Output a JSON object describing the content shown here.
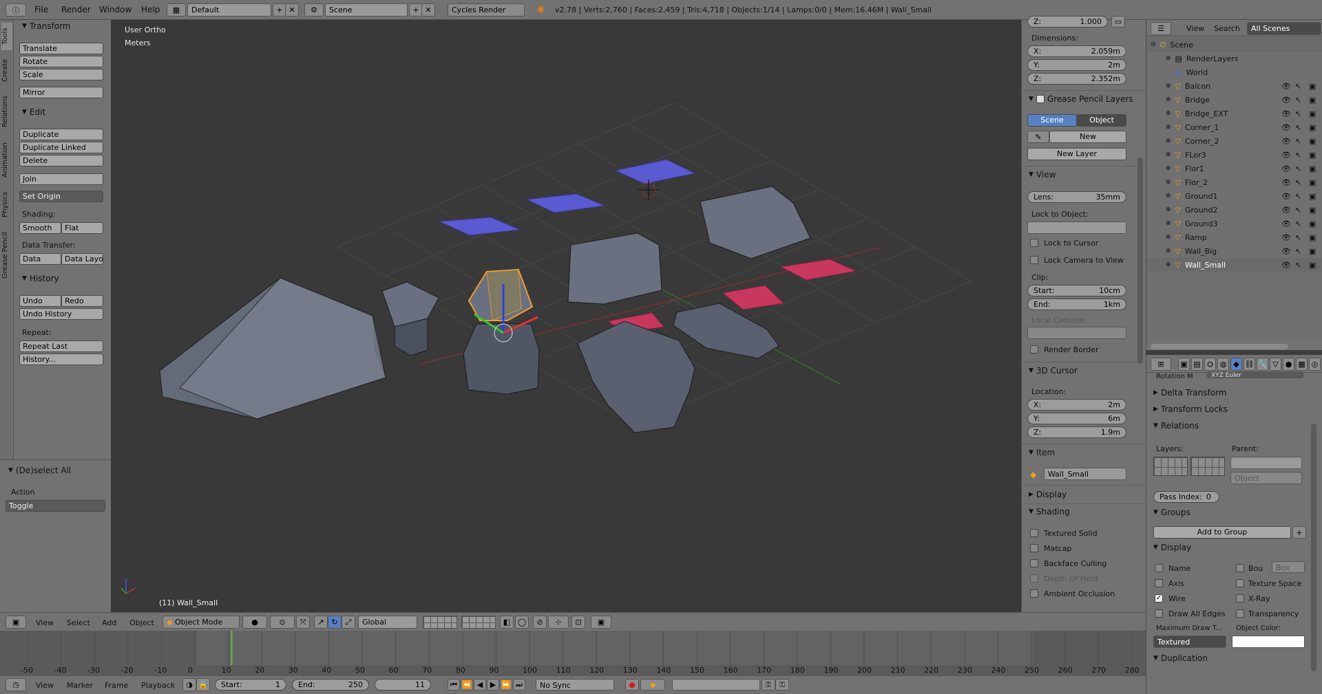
{
  "topbar": {
    "menus": [
      "File",
      "Render",
      "Window",
      "Help"
    ],
    "screen_layout": "Default",
    "scene": "Scene",
    "engine": "Cycles Render",
    "stats": "v2.78 | Verts:2,760 | Faces:2,459 | Tris:4,718 | Objects:1/14 | Lamps:0/0 | Mem:16.46M | Wall_Small"
  },
  "side_tabs": [
    "Tools",
    "Create",
    "Relations",
    "Animation",
    "Physics",
    "Grease Pencil"
  ],
  "toolshelf": {
    "transform_title": "Transform",
    "translate": "Translate",
    "rotate": "Rotate",
    "scale": "Scale",
    "mirror": "Mirror",
    "edit_title": "Edit",
    "duplicate": "Duplicate",
    "duplicate_linked": "Duplicate Linked",
    "delete": "Delete",
    "join": "Join",
    "set_origin": "Set Origin",
    "shading_label": "Shading:",
    "smooth": "Smooth",
    "flat": "Flat",
    "data_transfer_label": "Data Transfer:",
    "data": "Data",
    "data_layout": "Data Layo",
    "history_title": "History",
    "undo": "Undo",
    "redo": "Redo",
    "undo_history": "Undo History",
    "repeat_label": "Repeat:",
    "repeat_last": "Repeat Last",
    "history": "History...",
    "deselect_title": "(De)select All",
    "action_label": "Action",
    "action_value": "Toggle"
  },
  "viewport": {
    "view_name": "User Ortho",
    "units": "Meters",
    "active_object": "(11) Wall_Small"
  },
  "npanel": {
    "scale_z_label": "Z:",
    "scale_z_value": "1.000",
    "dimensions_label": "Dimensions:",
    "dim": [
      {
        "axis": "X:",
        "value": "2.059m"
      },
      {
        "axis": "Y:",
        "value": "2m"
      },
      {
        "axis": "Z:",
        "value": "2.352m"
      }
    ],
    "grease_title": "Grease Pencil Layers",
    "scene_tab": "Scene",
    "object_tab": "Object",
    "new": "New",
    "new_layer": "New Layer",
    "view_title": "View",
    "lens_label": "Lens:",
    "lens_value": "35mm",
    "lock_to_object": "Lock to Object:",
    "lock_to_cursor": "Lock to Cursor",
    "lock_camera": "Lock Camera to View",
    "clip_label": "Clip:",
    "clip_start_label": "Start:",
    "clip_start_value": "10cm",
    "clip_end_label": "End:",
    "clip_end_value": "1km",
    "local_camera": "Local Camera:",
    "render_border": "Render Border",
    "cursor_title": "3D Cursor",
    "location_label": "Location:",
    "cursor": [
      {
        "axis": "X:",
        "value": "2m"
      },
      {
        "axis": "Y:",
        "value": "6m"
      },
      {
        "axis": "Z:",
        "value": "1.9m"
      }
    ],
    "item_title": "Item",
    "item_name": "Wall_Small",
    "display_title": "Display",
    "shading_title": "Shading",
    "shading_opts": [
      "Textured Solid",
      "Matcap",
      "Backface Culling",
      "Depth Of Field",
      "Ambient Occlusion"
    ]
  },
  "outliner": {
    "view": "View",
    "search": "Search",
    "scenes": "All Scenes",
    "scene": "Scene",
    "render_layers": "RenderLayers",
    "world": "World",
    "objects": [
      "Balcon",
      "Bridge",
      "Bridge_EXT",
      "Corner_1",
      "Corner_2",
      "FLor3",
      "Flor1",
      "Flor_2",
      "Ground1",
      "Ground2",
      "Ground3",
      "Ramp",
      "Wall_Big",
      "Wall_Small"
    ]
  },
  "props": {
    "rotation_mode_label": "Rotation M",
    "rotation_mode_value": "XYZ Euler",
    "delta_transform": "Delta Transform",
    "transform_locks": "Transform Locks",
    "relations": "Relations",
    "layers_label": "Layers:",
    "parent_label": "Parent:",
    "parent_type": "Object",
    "pass_index_label": "Pass Index:",
    "pass_index_value": "0",
    "groups": "Groups",
    "add_to_group": "Add to Group",
    "display": "Display",
    "name": "Name",
    "bounds": "Bou",
    "bounds_type": "Box",
    "axis": "Axis",
    "texture_space": "Texture Space",
    "wire": "Wire",
    "xray": "X-Ray",
    "draw_all_edges": "Draw All Edges",
    "transparency": "Transparency",
    "max_draw_label": "Maximum Draw T...",
    "max_draw_value": "Textured",
    "object_color": "Object Color:",
    "duplication": "Duplication"
  },
  "vheader": {
    "view": "View",
    "select": "Select",
    "add": "Add",
    "object": "Object",
    "mode": "Object Mode",
    "orientation": "Global"
  },
  "timeline": {
    "ticks": [
      "-50",
      "-40",
      "-30",
      "-20",
      "-10",
      "0",
      "10",
      "20",
      "30",
      "40",
      "50",
      "60",
      "70",
      "80",
      "90",
      "100",
      "110",
      "120",
      "130",
      "140",
      "150",
      "160",
      "170",
      "180",
      "190",
      "200",
      "210",
      "220",
      "230",
      "240",
      "250",
      "260",
      "270",
      "280"
    ],
    "current_frame": 11
  },
  "tlheader": {
    "view": "View",
    "marker": "Marker",
    "frame": "Frame",
    "playback": "Playback",
    "start_label": "Start:",
    "start_value": "1",
    "end_label": "End:",
    "end_value": "250",
    "current": "11",
    "sync": "No Sync"
  },
  "colors": {
    "accent": "#5680c2",
    "selected": "#f39c2e",
    "panel": "#727272",
    "viewport": "#393939"
  }
}
